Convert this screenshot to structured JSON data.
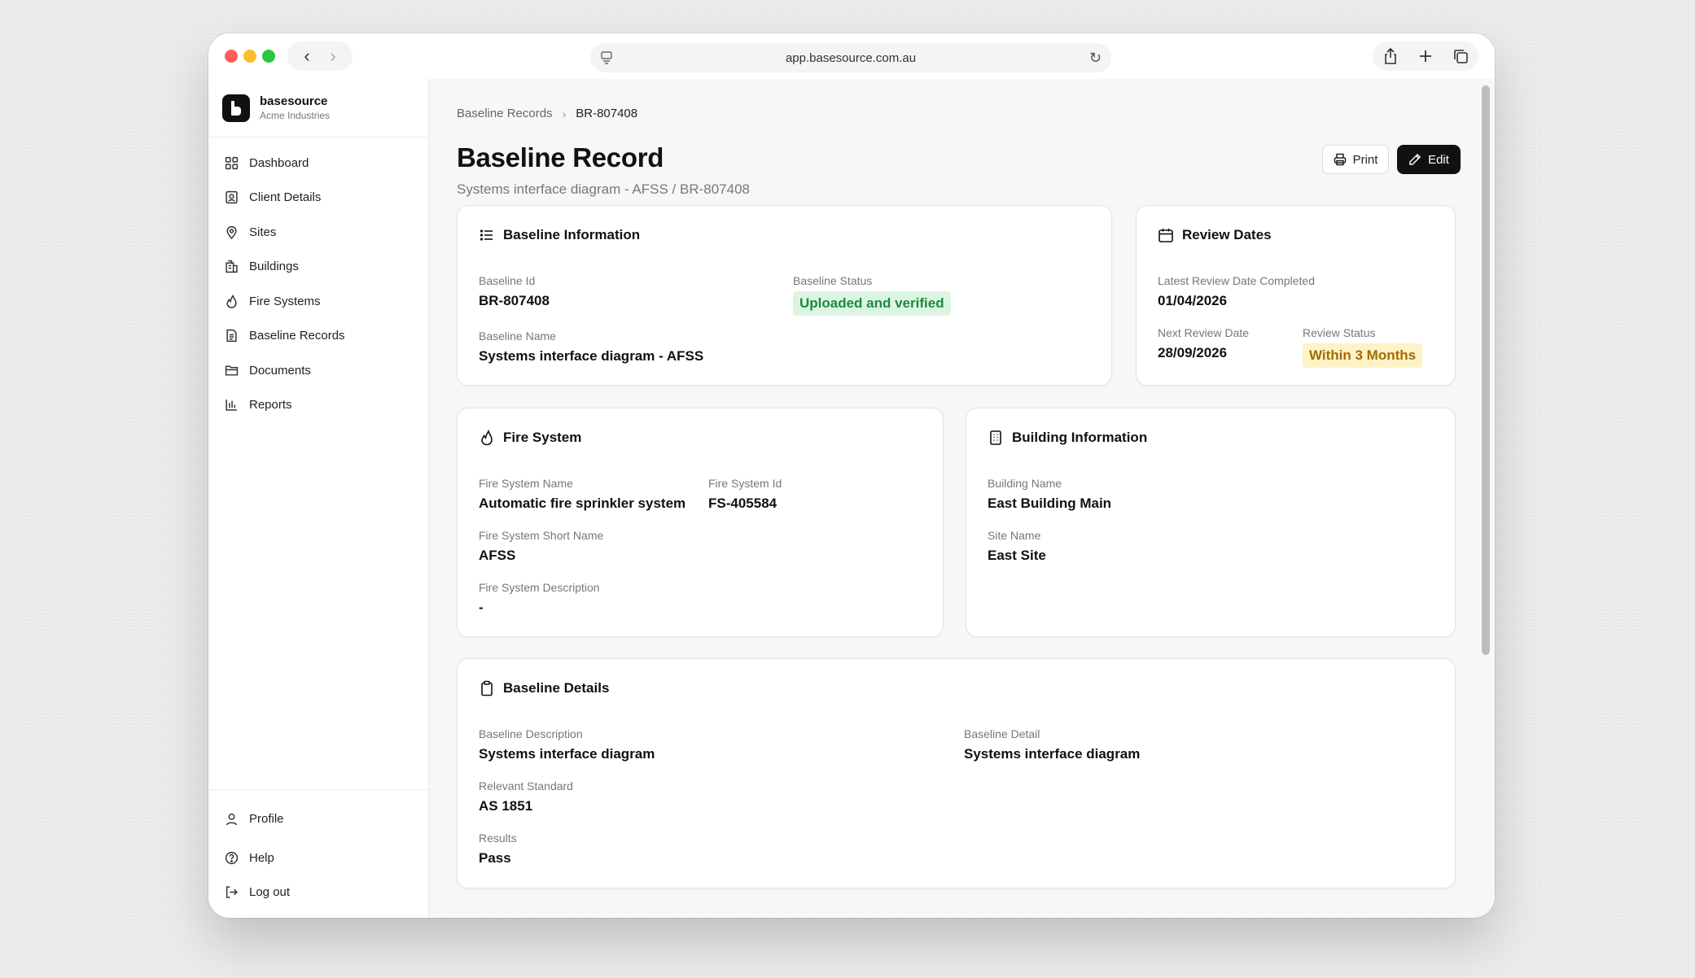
{
  "browser": {
    "url": "app.basesource.com.au"
  },
  "brand": {
    "name": "basesource",
    "org": "Acme Industries"
  },
  "nav": {
    "items": [
      {
        "label": "Dashboard",
        "icon": "dashboard-icon"
      },
      {
        "label": "Client Details",
        "icon": "client-details-icon"
      },
      {
        "label": "Sites",
        "icon": "map-pin-icon"
      },
      {
        "label": "Buildings",
        "icon": "building-icon"
      },
      {
        "label": "Fire Systems",
        "icon": "flame-icon"
      },
      {
        "label": "Baseline Records",
        "icon": "file-text-icon"
      },
      {
        "label": "Documents",
        "icon": "folder-icon"
      },
      {
        "label": "Reports",
        "icon": "bar-chart-icon"
      }
    ],
    "bottom": {
      "profile": "Profile",
      "help": "Help",
      "logout": "Log out"
    }
  },
  "breadcrumb": {
    "parent": "Baseline Records",
    "current": "BR-807408"
  },
  "header": {
    "title": "Baseline Record",
    "subtitle": "Systems interface diagram - AFSS / BR-807408",
    "print_label": "Print",
    "edit_label": "Edit"
  },
  "baseline_info": {
    "title": "Baseline Information",
    "id_label": "Baseline Id",
    "id_value": "BR-807408",
    "status_label": "Baseline Status",
    "status_value": "Uploaded and verified",
    "name_label": "Baseline Name",
    "name_value": "Systems interface diagram - AFSS"
  },
  "review_dates": {
    "title": "Review Dates",
    "latest_label": "Latest Review Date Completed",
    "latest_value": "01/04/2026",
    "next_label": "Next Review Date",
    "next_value": "28/09/2026",
    "status_label": "Review Status",
    "status_value": "Within 3 Months"
  },
  "fire_system": {
    "title": "Fire System",
    "name_label": "Fire System Name",
    "name_value": "Automatic fire sprinkler system",
    "id_label": "Fire System Id",
    "id_value": "FS-405584",
    "short_label": "Fire System Short Name",
    "short_value": "AFSS",
    "desc_label": "Fire System Description",
    "desc_value": "-"
  },
  "building_info": {
    "title": "Building Information",
    "building_label": "Building Name",
    "building_value": "East Building Main",
    "site_label": "Site Name",
    "site_value": "East Site"
  },
  "baseline_details": {
    "title": "Baseline Details",
    "desc_label": "Baseline Description",
    "desc_value": "Systems interface diagram",
    "detail_label": "Baseline Detail",
    "detail_value": "Systems interface diagram",
    "standard_label": "Relevant Standard",
    "standard_value": "AS 1851",
    "results_label": "Results",
    "results_value": "Pass"
  },
  "colors": {
    "accent": "#111111",
    "status_green_bg": "#dcf5e3",
    "status_green_text": "#1d8a3c",
    "status_yellow_bg": "#fdf3c7",
    "status_yellow_text": "#a56a00"
  }
}
